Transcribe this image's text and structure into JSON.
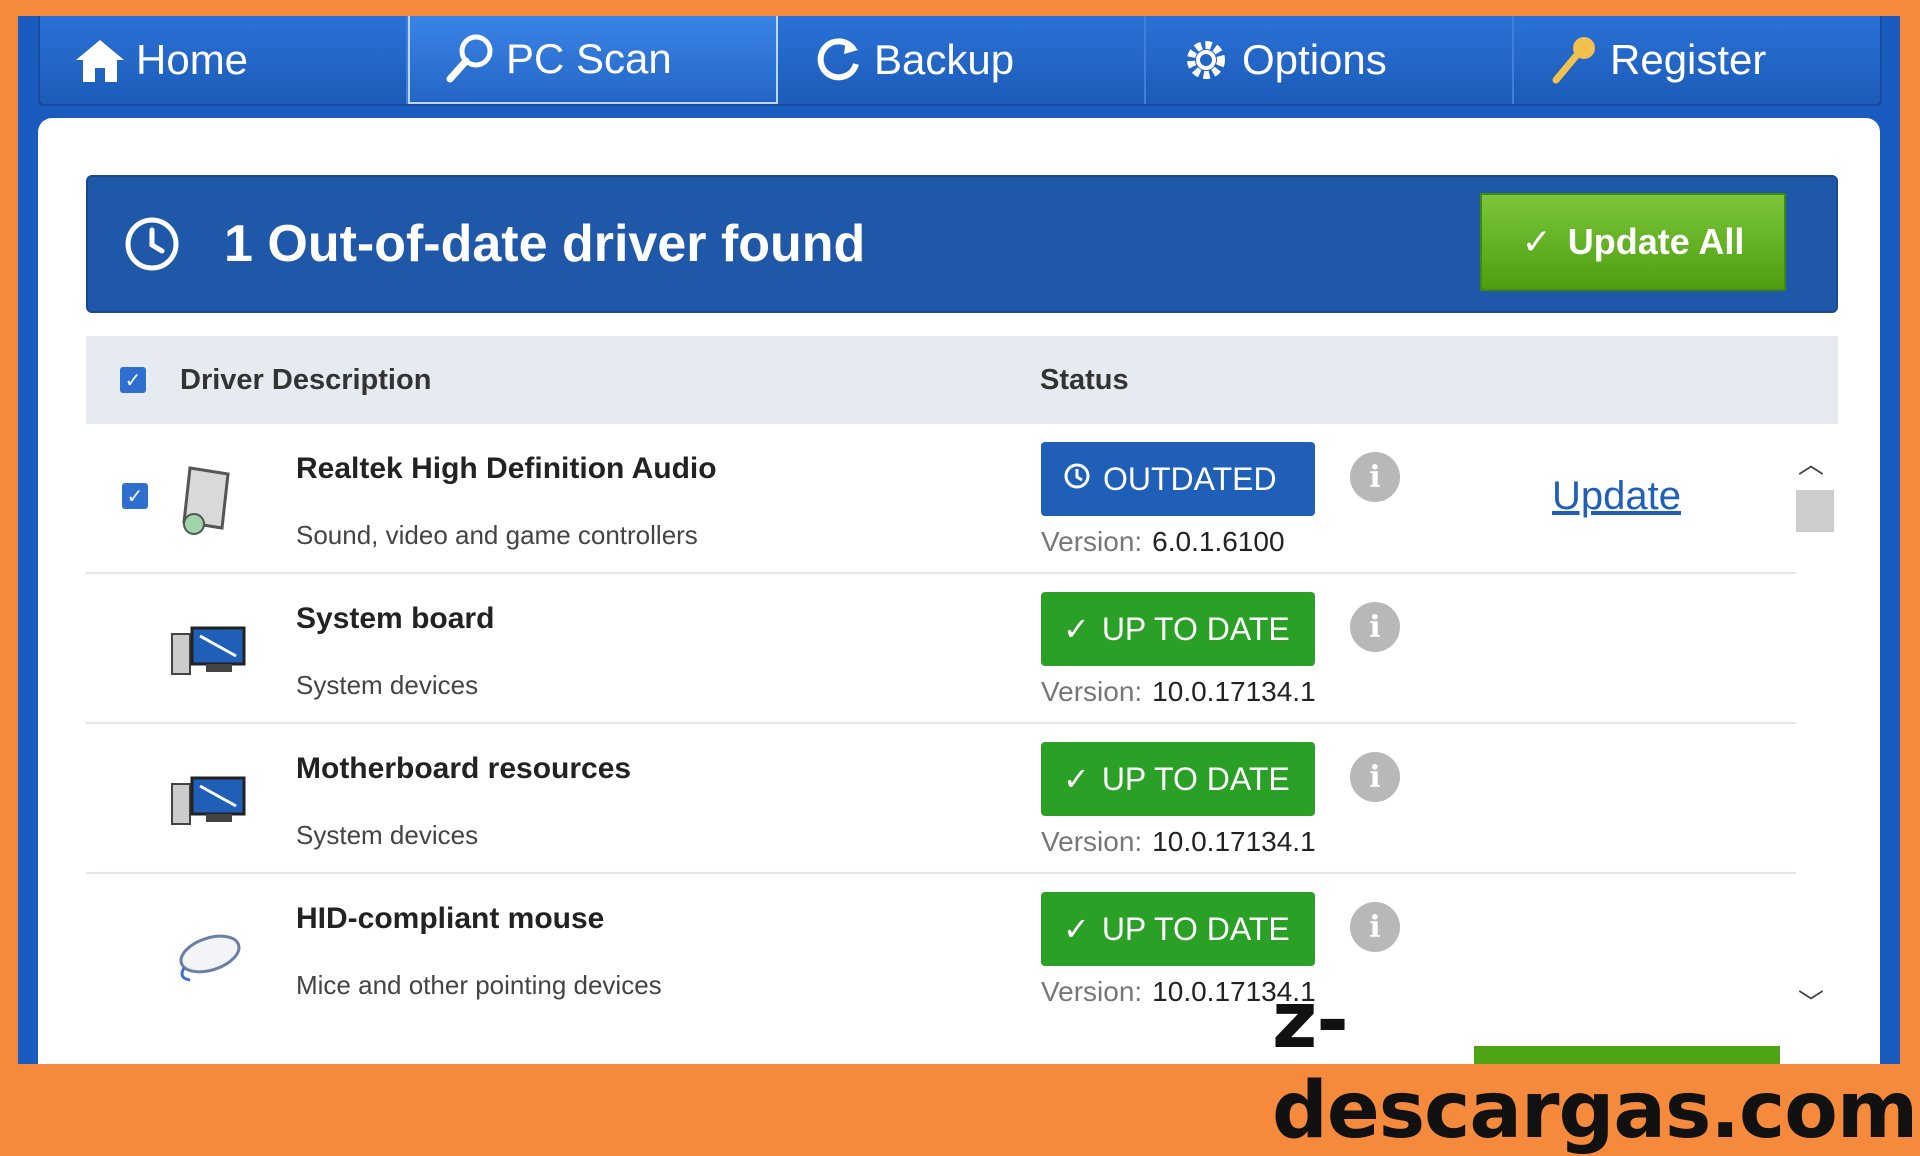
{
  "nav": {
    "tabs": [
      {
        "label": "Home",
        "icon": "home-icon"
      },
      {
        "label": "PC Scan",
        "icon": "magnifier-icon",
        "active": true
      },
      {
        "label": "Backup",
        "icon": "refresh-icon"
      },
      {
        "label": "Options",
        "icon": "gear-icon"
      },
      {
        "label": "Register",
        "icon": "key-icon"
      }
    ]
  },
  "banner": {
    "title": "1 Out-of-date driver found",
    "update_all_label": "Update All"
  },
  "table": {
    "col_desc": "Driver Description",
    "col_status": "Status",
    "version_label": "Version:",
    "rows": [
      {
        "name": "Realtek High Definition Audio",
        "category": "Sound, video and game controllers",
        "status": "OUTDATED",
        "version": "6.0.1.6100",
        "action": "Update",
        "icon": "audio-device-icon"
      },
      {
        "name": "System board",
        "category": "System devices",
        "status": "UP TO DATE",
        "version": "10.0.17134.1",
        "icon": "computer-icon"
      },
      {
        "name": "Motherboard resources",
        "category": "System devices",
        "status": "UP TO DATE",
        "version": "10.0.17134.1",
        "icon": "computer-icon"
      },
      {
        "name": "HID-compliant mouse",
        "category": "Mice and other pointing devices",
        "status": "UP TO DATE",
        "version": "10.0.17134.1",
        "icon": "mouse-icon"
      }
    ]
  },
  "watermark": "z-descargas.com",
  "colors": {
    "frame": "#f58a3c",
    "nav_blue": "#1c5bb8",
    "outdated": "#1f5fb8",
    "ok_green": "#2aa026"
  }
}
